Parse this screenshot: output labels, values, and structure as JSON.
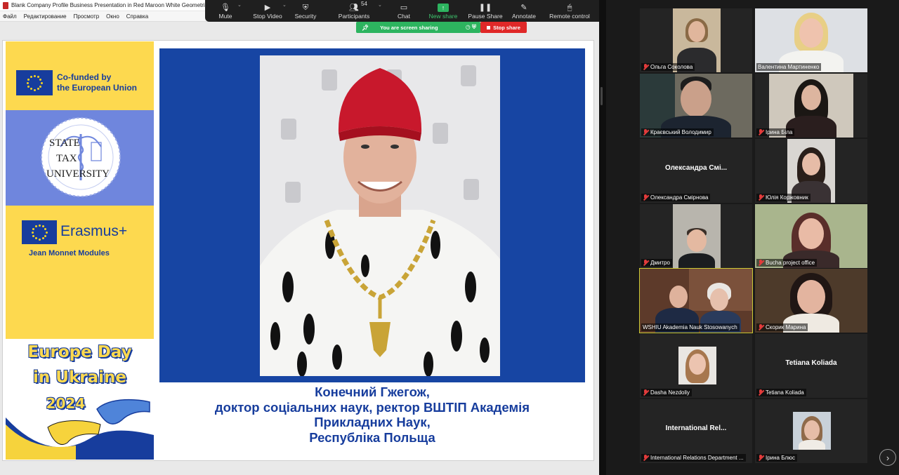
{
  "pdf_window": {
    "title": "Blank Company Profile Business Presentation in Red Maroon White Geometri",
    "menu": [
      "Файл",
      "Редактирование",
      "Просмотр",
      "Окно",
      "Справка"
    ]
  },
  "toolbar": {
    "mute": "Mute",
    "stop_video": "Stop Video",
    "security": "Security",
    "participants": "Participants",
    "participants_count": "54",
    "chat": "Chat",
    "new_share": "New share",
    "pause_share": "Pause Share",
    "annotate": "Annotate",
    "remote_control": "Remote control"
  },
  "sharing": {
    "status": "You are screen sharing",
    "stop": "Stop share"
  },
  "slide": {
    "eu_line1": "Co-funded by",
    "eu_line2": "the European Union",
    "university_line1": "STATE",
    "university_line2": "TAX",
    "university_line3": "UNIVERSITY",
    "erasmus": "Erasmus+",
    "jean_monnet": "Jean Monnet Modules",
    "europe_day_line1": "Europe Day",
    "europe_day_line2": "in Ukraine",
    "europe_day_year": "2024",
    "caption_line1": "Конечний Гжегож,",
    "caption_line2": "доктор соціальних наук, ректор ВШТІП Академія",
    "caption_line3": "Прикладних Наук,",
    "caption_line4": "Республіка Польща"
  },
  "participants": [
    {
      "name": "Ольга Соколова"
    },
    {
      "name": "Валентина Мартиненко"
    },
    {
      "name": "Краєвський Володимир"
    },
    {
      "name": "Ірина Біла"
    },
    {
      "name": "Олександра Смірнова",
      "center_label": "Олександра Смі..."
    },
    {
      "name": "Юлія Корж­овник"
    },
    {
      "name": "Дмитро"
    },
    {
      "name": "Bucha project office"
    },
    {
      "name": "WSHIU Akademia Nauk Stosowanych"
    },
    {
      "name": "Скорик Марина"
    },
    {
      "name": "Dasha Nezdoliy"
    },
    {
      "name": "Tetiana Koliada",
      "center_label": "Tetiana Koliada"
    },
    {
      "name": "International Relations Department ...",
      "center_label": "International  Rel..."
    },
    {
      "name": "Ірина Блюс"
    }
  ],
  "colors": {
    "eu_blue": "#173d9d",
    "slide_yellow": "#fdd94f",
    "slide_blue": "#1745a3",
    "share_green": "#2db45f",
    "stop_red": "#e02828",
    "mic_muted_red": "#e23b3b",
    "active_speaker": "#ccca35"
  },
  "icons": [
    "pdf-icon",
    "mic-icon",
    "video-icon",
    "shield-icon",
    "participants-icon",
    "chat-icon",
    "share-up-arrow-icon",
    "pause-icon",
    "pen-icon",
    "mouse-icon",
    "pin-icon",
    "mic-off-icon",
    "next-page-icon"
  ]
}
